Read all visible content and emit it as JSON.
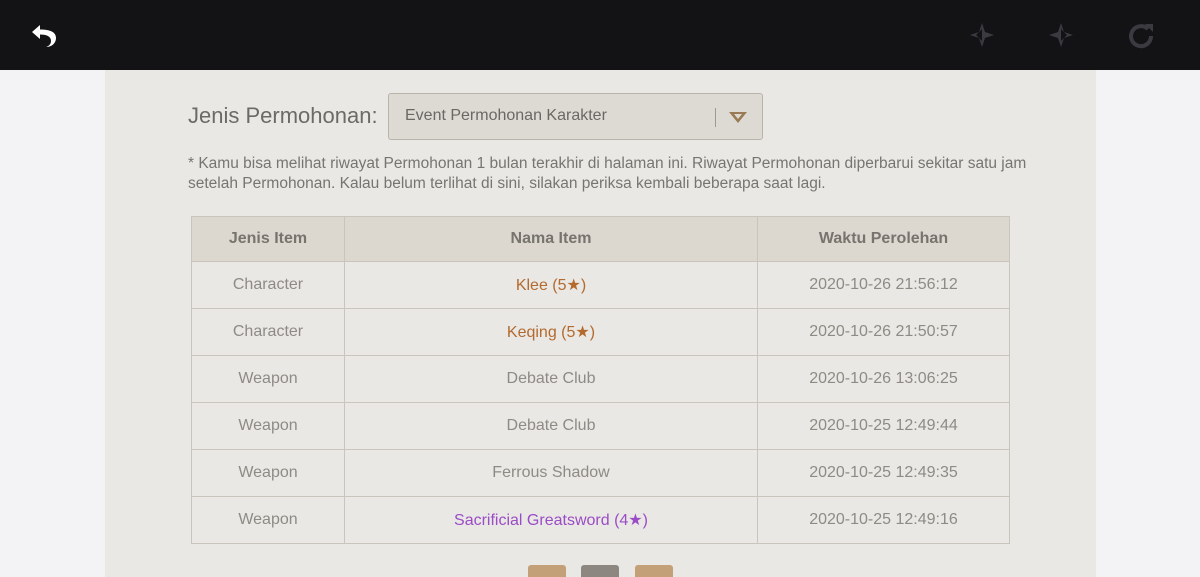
{
  "topbar": {
    "icons": [
      "back-arrow-icon",
      "prev-star-icon",
      "next-star-icon",
      "refresh-icon"
    ],
    "colors": {
      "bar": "#131316",
      "active_icon": "#ffffff",
      "inactive_icon": "#3a3a40"
    }
  },
  "filter": {
    "label": "Jenis Permohonan:",
    "selected": "Event Permohonan Karakter"
  },
  "note": "* Kamu bisa melihat riwayat Permohonan 1 bulan terakhir di halaman ini. Riwayat Permohonan diperbarui sekitar satu jam setelah Permohonan. Kalau belum terlihat di sini, silakan periksa kembali beberapa saat lagi.",
  "table": {
    "headers": [
      "Jenis Item",
      "Nama Item",
      "Waktu Perolehan"
    ],
    "rows": [
      {
        "type": "Character",
        "name": "Klee (5★)",
        "time": "2020-10-26 21:56:12",
        "rarity": "5"
      },
      {
        "type": "Character",
        "name": "Keqing (5★)",
        "time": "2020-10-26 21:50:57",
        "rarity": "5"
      },
      {
        "type": "Weapon",
        "name": "Debate Club",
        "time": "2020-10-26 13:06:25",
        "rarity": "3"
      },
      {
        "type": "Weapon",
        "name": "Debate Club",
        "time": "2020-10-25 12:49:44",
        "rarity": "3"
      },
      {
        "type": "Weapon",
        "name": "Ferrous Shadow",
        "time": "2020-10-25 12:49:35",
        "rarity": "3"
      },
      {
        "type": "Weapon",
        "name": "Sacrificial Greatsword (4★)",
        "time": "2020-10-25 12:49:16",
        "rarity": "4"
      }
    ]
  },
  "colors": {
    "five_star": "#b46a2e",
    "four_star": "#9b4cc6",
    "three_star": "#8e8b84"
  }
}
